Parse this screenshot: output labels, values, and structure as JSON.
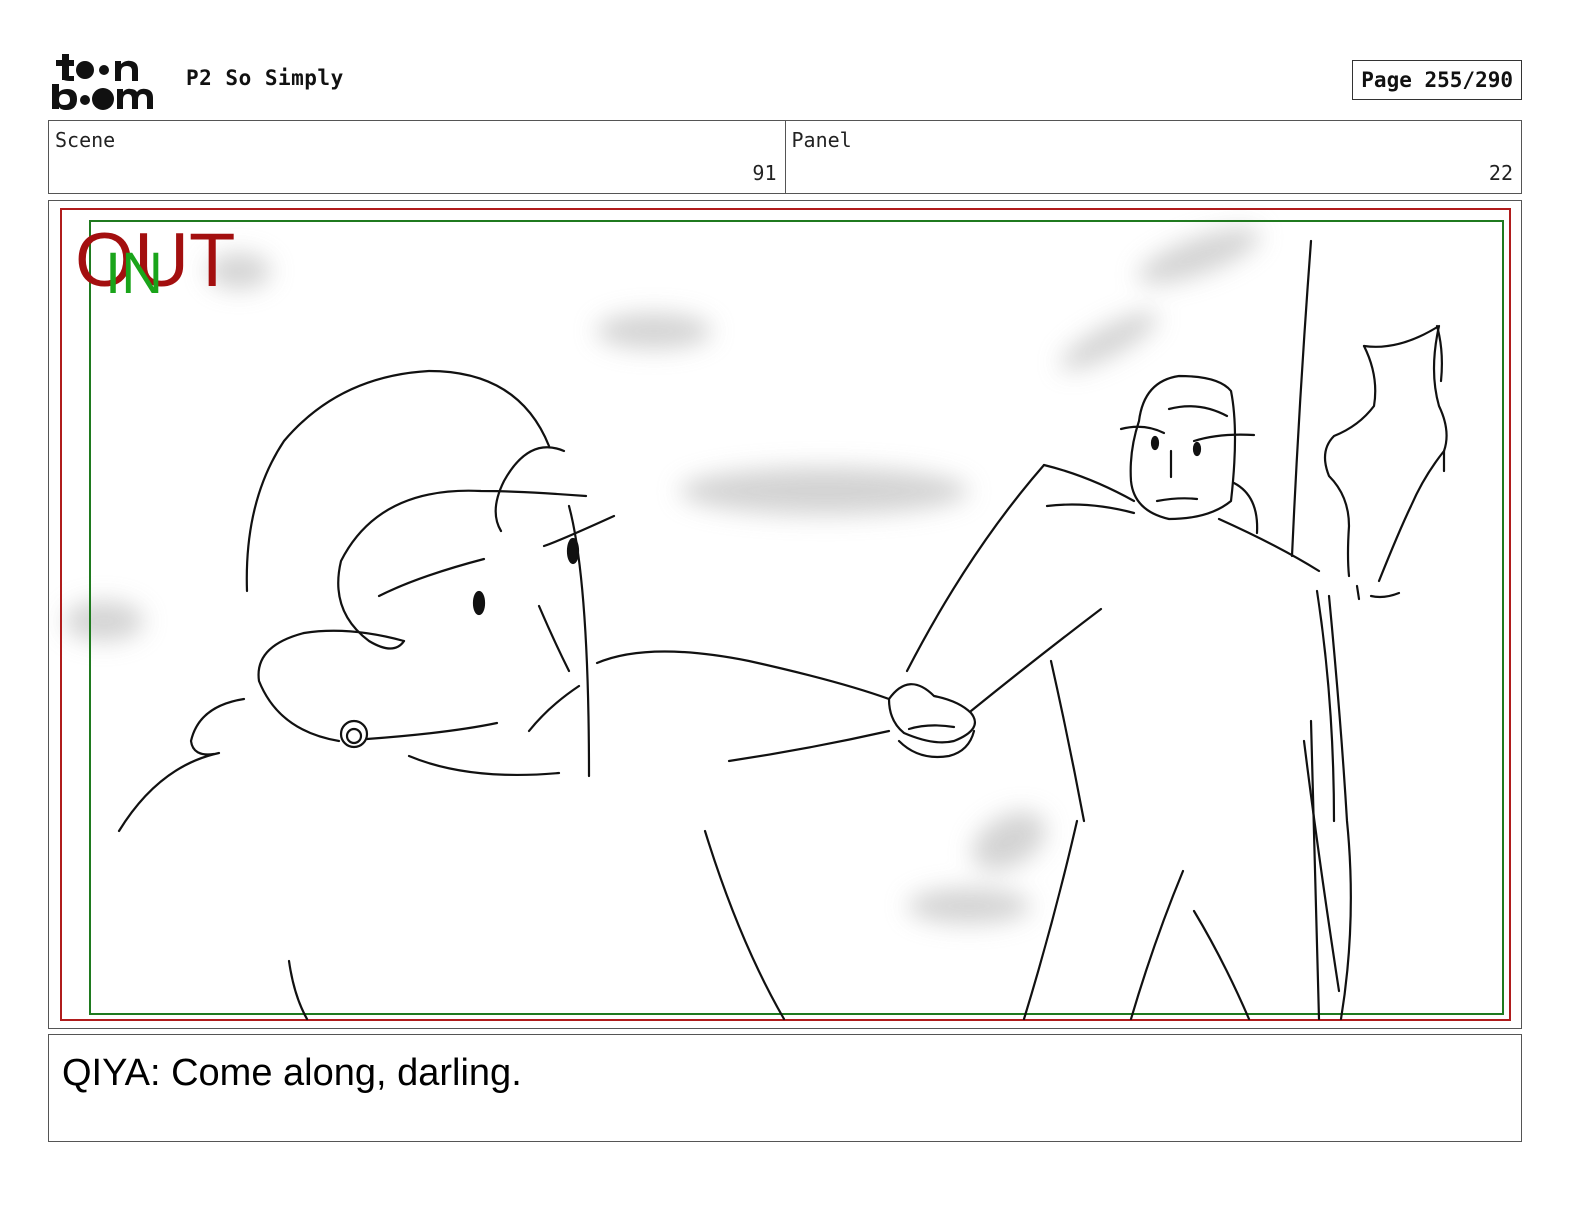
{
  "header": {
    "logo_text": "toon boom",
    "project_title": "P2 So Simply",
    "page_label": "Page 255/290"
  },
  "info": {
    "scene_label": "Scene",
    "scene_value": "91",
    "panel_label": "Panel",
    "panel_value": "22"
  },
  "panel": {
    "out_label": "OUT",
    "in_label": "IN",
    "colors": {
      "out_frame": "#b01c1c",
      "in_frame": "#1f7a1f",
      "sketch": "#111111",
      "smudge": "#cfcfcf"
    }
  },
  "dialogue": {
    "text": "QIYA: Come along, darling."
  }
}
